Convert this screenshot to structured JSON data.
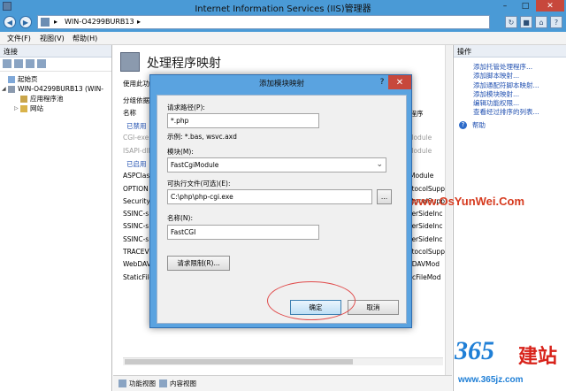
{
  "window": {
    "title": "Internet Information Services (IIS)管理器",
    "controls": {
      "minimize": "–",
      "maximize": "□",
      "close": "✕"
    }
  },
  "address_bar": {
    "segments": [
      "WIN-O4299BURB13",
      "▸"
    ]
  },
  "menu": [
    "文件(F)",
    "视图(V)",
    "帮助(H)"
  ],
  "connections": {
    "header": "连接",
    "tree": [
      {
        "label": "起始页",
        "level": 0,
        "arrow": ""
      },
      {
        "label": "WIN-O4299BURB13 (WIN-",
        "level": 0,
        "arrow": "◢"
      },
      {
        "label": "应用程序池",
        "level": 1,
        "arrow": ""
      },
      {
        "label": "网站",
        "level": 1,
        "arrow": "▷"
      }
    ]
  },
  "feature_page": {
    "title": "处理程序映射",
    "description": "使用此功能",
    "group_header": "分组依据",
    "col_name": "名称",
    "col_path_type": "径程序",
    "rows": [
      {
        "name": "已禁用",
        "right": "",
        "is_group": true
      },
      {
        "name": "CGI-exe",
        "right": "Module",
        "is_group": false,
        "dim": true
      },
      {
        "name": "ISAPI-dll",
        "right": "Module",
        "is_group": false,
        "dim": true
      },
      {
        "name": "已启用",
        "right": "",
        "is_group": true
      },
      {
        "name": "ASPClass",
        "right": "iModule",
        "is_group": false
      },
      {
        "name": "OPTION",
        "right": "otocolSupp",
        "is_group": false
      },
      {
        "name": "Security",
        "right": "otocolSupp",
        "is_group": false
      },
      {
        "name": "SSINC-s",
        "right": "verSideInc",
        "is_group": false
      },
      {
        "name": "SSINC-s",
        "right": "verSideInc",
        "is_group": false
      },
      {
        "name": "SSINC-s",
        "right": "verSideInc",
        "is_group": false
      },
      {
        "name": "TRACEV",
        "right": "otocolSupp",
        "is_group": false
      },
      {
        "name": "WebDAV",
        "right": "bDAVMod",
        "is_group": false
      },
      {
        "name": "StaticFile",
        "right": "ticFileMod",
        "is_group": false
      }
    ]
  },
  "bottom_tabs": [
    "功能视图",
    "内容视图"
  ],
  "actions": {
    "header": "操作",
    "items": [
      "添加托管处理程序...",
      "添加脚本映射...",
      "添加通配符脚本映射...",
      "添加模块映射...",
      "编辑功能权限...",
      "查看经过排序的列表..."
    ],
    "help": "帮助"
  },
  "dialog": {
    "title": "添加模块映射",
    "help": "?",
    "close": "✕",
    "request_path_label": "请求路径(P):",
    "request_path_value": "*.php",
    "example": "示例: *.bas, wsvc.axd",
    "module_label": "模块(M):",
    "module_value": "FastCgiModule",
    "exe_label": "可执行文件(可选)(E):",
    "exe_value": "C:\\php\\php-cgi.exe",
    "browse_label": "...",
    "name_label": "名称(N):",
    "name_value": "FastCGI",
    "restrictions_button": "请求限制(R)...",
    "ok_button": "确定",
    "cancel_button": "取消"
  },
  "watermark": {
    "site": "www.OsYunWei.Com",
    "logo_number": "365",
    "logo_text": "建站",
    "logo_url": "www.365jz.com"
  },
  "colors": {
    "chrome_blue": "#4a9ad6",
    "dialog_blue": "#5aa3e0",
    "link_blue": "#1f4fb0",
    "close_red": "#c7483c",
    "annotation_red": "#e04a4a"
  }
}
